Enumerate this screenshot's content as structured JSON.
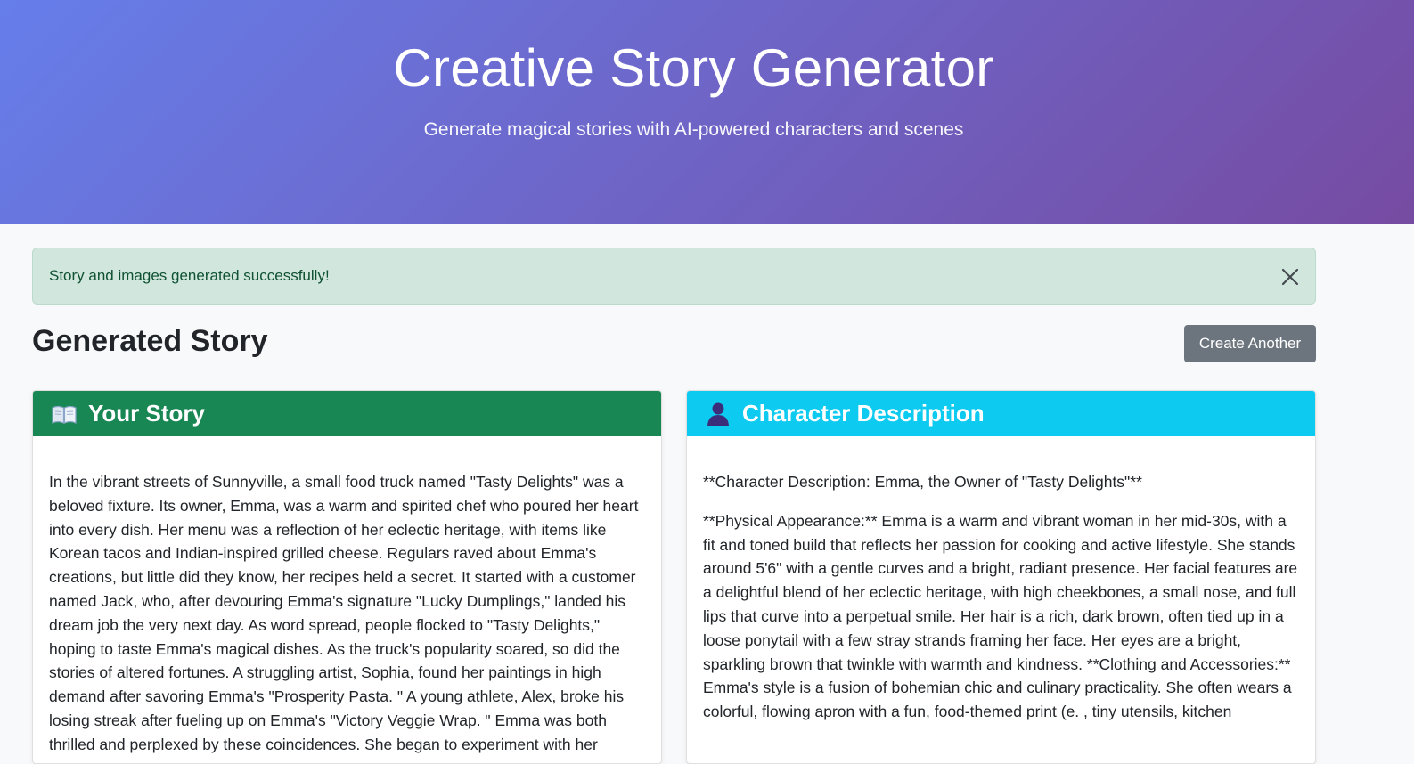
{
  "hero": {
    "title": "Creative Story Generator",
    "subtitle": "Generate magical stories with AI-powered characters and scenes"
  },
  "alert": {
    "message": "Story and images generated successfully!",
    "close_icon": "close-icon"
  },
  "section": {
    "title": "Generated Story",
    "create_another_label": "Create Another"
  },
  "story_card": {
    "icon": "book-icon",
    "title": "Your Story",
    "text": "In the vibrant streets of Sunnyville, a small food truck named \"Tasty Delights\" was a beloved fixture. Its owner, Emma, was a warm and spirited chef who poured her heart into every dish. Her menu was a reflection of her eclectic heritage, with items like Korean tacos and Indian-inspired grilled cheese. Regulars raved about Emma's creations, but little did they know, her recipes held a secret. It started with a customer named Jack, who, after devouring Emma's signature \"Lucky Dumplings,\" landed his dream job the very next day. As word spread, people flocked to \"Tasty Delights,\" hoping to taste Emma's magical dishes. As the truck's popularity soared, so did the stories of altered fortunes. A struggling artist, Sophia, found her paintings in high demand after savoring Emma's \"Prosperity Pasta. \" A young athlete, Alex, broke his losing streak after fueling up on Emma's \"Victory Veggie Wrap. \" Emma was both thrilled and perplexed by these coincidences. She began to experiment with her"
  },
  "character_card": {
    "icon": "person-icon",
    "title": "Character Description",
    "heading": "**Character Description: Emma, the Owner of \"Tasty Delights\"**",
    "text": "**Physical Appearance:** Emma is a warm and vibrant woman in her mid-30s, with a fit and toned build that reflects her passion for cooking and active lifestyle. She stands around 5'6\" with a gentle curves and a bright, radiant presence. Her facial features are a delightful blend of her eclectic heritage, with high cheekbones, a small nose, and full lips that curve into a perpetual smile. Her hair is a rich, dark brown, often tied up in a loose ponytail with a few stray strands framing her face. Her eyes are a bright, sparkling brown that twinkle with warmth and kindness. **Clothing and Accessories:** Emma's style is a fusion of bohemian chic and culinary practicality. She often wears a colorful, flowing apron with a fun, food-themed print (e. , tiny utensils, kitchen"
  }
}
